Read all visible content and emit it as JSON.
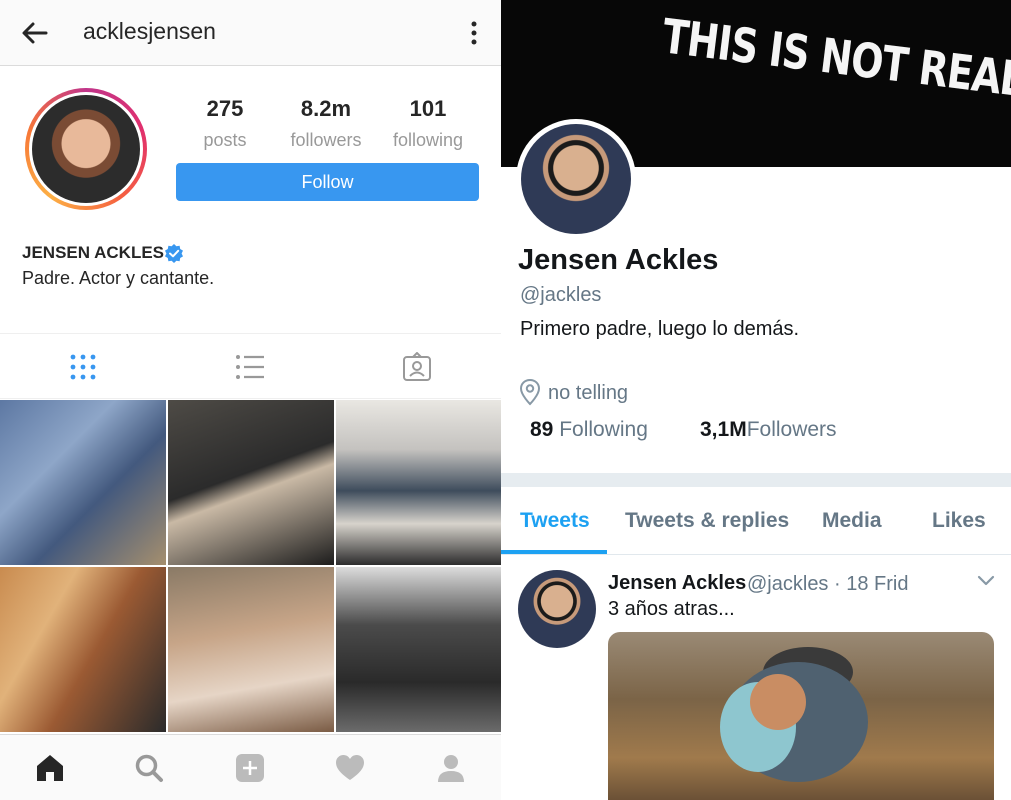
{
  "instagram": {
    "header": {
      "username": "acklesjensen"
    },
    "stats": [
      {
        "value": "275",
        "label": "posts"
      },
      {
        "value": "8.2m",
        "label": "followers"
      },
      {
        "value": "101",
        "label": "following"
      }
    ],
    "follow_label": "Follow",
    "profile": {
      "name": "JENSEN ACKLES",
      "bio": "Padre. Actor y cantante."
    },
    "tabs": [
      "grid-icon",
      "list-icon",
      "tagged-icon"
    ],
    "bottom_nav": [
      "home-icon",
      "search-icon",
      "add-post-icon",
      "heart-icon",
      "profile-icon"
    ],
    "colors": {
      "follow_button": "#3897f0",
      "verified": "#3897f0",
      "active_tab": "#3897f0"
    }
  },
  "twitter": {
    "banner_text": "THIS IS NOT REAL LIFE",
    "profile": {
      "name": "Jensen Ackles",
      "handle": "@jackles",
      "bio": "Primero padre, luego lo demás.",
      "location": "no telling",
      "following_count": "89",
      "following_label": "Following",
      "followers_count": "3,1M",
      "followers_label": "Followers"
    },
    "tabs": [
      "Tweets",
      "Tweets & replies",
      "Media",
      "Likes"
    ],
    "active_tab": "Tweets",
    "tweet": {
      "name": "Jensen Ackles",
      "meta": "@jackles · 18 Frid",
      "text": "3 años atras..."
    },
    "colors": {
      "accent": "#1da1f2",
      "muted": "#657786"
    }
  }
}
